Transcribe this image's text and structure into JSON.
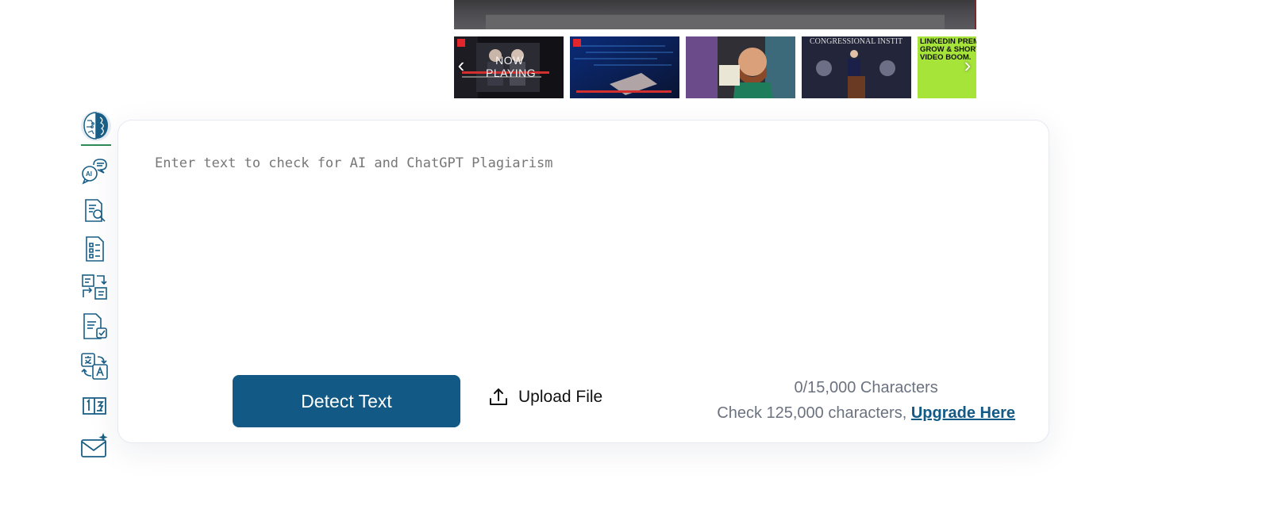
{
  "video": {
    "now_playing": "NOW PLAYING",
    "thumbnails": [
      {
        "name": "thumb-now-playing"
      },
      {
        "name": "thumb-hacker-keyboard"
      },
      {
        "name": "thumb-bearded-man"
      },
      {
        "name": "thumb-congressional-stage",
        "text": "CONGRESSIONAL INSTIT"
      },
      {
        "name": "thumb-linkedin",
        "text": "LINKEDIN PREMI REVENUE GROW & SHORT-FORM VIDEO BOOM."
      }
    ]
  },
  "rail": {
    "items": [
      {
        "icon": "brain-logo-icon"
      },
      {
        "icon": "ai-chat-icon"
      },
      {
        "icon": "document-search-icon"
      },
      {
        "icon": "checklist-document-icon"
      },
      {
        "icon": "rewrite-tool-icon"
      },
      {
        "icon": "document-check-icon"
      },
      {
        "icon": "translate-icon"
      },
      {
        "icon": "word-counter-icon"
      },
      {
        "icon": "mail-sparkle-icon"
      }
    ]
  },
  "editor": {
    "placeholder": "Enter text to check for AI and ChatGPT Plagiarism"
  },
  "actions": {
    "detect_label": "Detect Text",
    "upload_label": "Upload File"
  },
  "counter": {
    "count_text": "0/15,000 Characters",
    "upsell_text": "Check 125,000 characters,",
    "upgrade_link": "Upgrade Here"
  },
  "colors": {
    "primary": "#125a85",
    "rail_icon": "#1a5f86",
    "muted_text": "#6b7280"
  }
}
